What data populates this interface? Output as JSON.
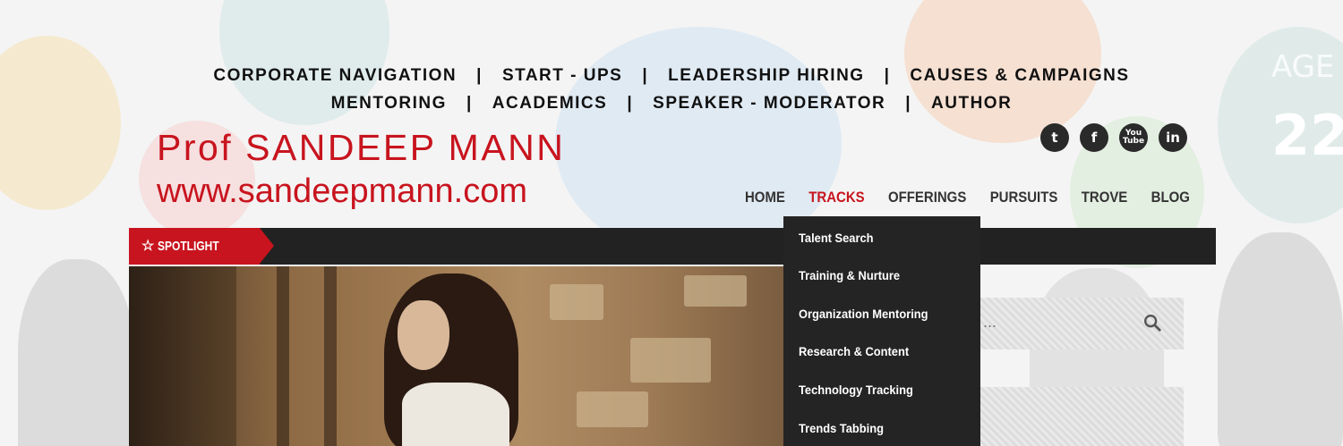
{
  "top_nav": {
    "row1": [
      "CORPORATE NAVIGATION",
      "START - UPS",
      "LEADERSHIP HIRING",
      "CAUSES & CAMPAIGNS"
    ],
    "row2": [
      "MENTORING",
      "ACADEMICS",
      "SPEAKER - MODERATOR",
      "AUTHOR"
    ],
    "separator": "|"
  },
  "brand": {
    "name": "Prof SANDEEP MANN",
    "url": "www.sandeepmann.com"
  },
  "social": [
    {
      "name": "twitter-icon",
      "glyph": "t"
    },
    {
      "name": "facebook-icon",
      "glyph": "f"
    },
    {
      "name": "youtube-icon",
      "glyph": "You Tube"
    },
    {
      "name": "linkedin-icon",
      "glyph": "in"
    }
  ],
  "main_nav": {
    "items": [
      "HOME",
      "TRACKS",
      "OFFERINGS",
      "PURSUITS",
      "TROVE",
      "BLOG"
    ],
    "active": "TRACKS"
  },
  "spotlight": {
    "label": "SPOTLIGHT",
    "icon": "star-icon"
  },
  "dropdown": {
    "items": [
      "Talent Search",
      "Training & Nurture",
      "Organization Mentoring",
      "Research & Content",
      "Technology Tracking",
      "Trends Tabbing"
    ]
  },
  "search": {
    "placeholder": "..."
  },
  "background": {
    "age_label": "AGE",
    "age_value": "22"
  },
  "colors": {
    "brand_red": "#c8141e",
    "dark": "#242424"
  }
}
